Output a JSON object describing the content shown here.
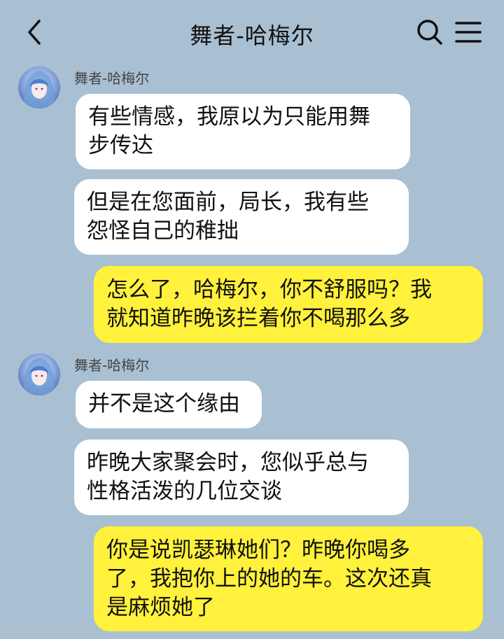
{
  "header": {
    "title": "舞者-哈梅尔",
    "back_icon": "chevron-left-icon",
    "search_icon": "search-icon",
    "menu_icon": "hamburger-menu-icon"
  },
  "colors": {
    "background": "#a9bfd2",
    "incoming_bubble": "#ffffff",
    "outgoing_bubble": "#fff13c"
  },
  "messages": [
    {
      "sender": "舞者-哈梅尔",
      "direction": "incoming",
      "bubbles": [
        "有些情感，我原以为只能用舞\n步传达",
        "但是在您面前，局长，我有些\n怨怪自己的稚拙"
      ]
    },
    {
      "direction": "outgoing",
      "bubbles": [
        "怎么了，哈梅尔，你不舒服吗？我\n就知道昨晚该拦着你不喝那么多"
      ]
    },
    {
      "sender": "舞者-哈梅尔",
      "direction": "incoming",
      "bubbles": [
        "并不是这个缘由",
        "昨晚大家聚会时，您似乎总与\n性格活泼的几位交谈"
      ]
    },
    {
      "direction": "outgoing",
      "bubbles": [
        "你是说凯瑟琳她们？昨晚你喝多\n了，我抱你上的她的车。这次还真\n是麻烦她了"
      ]
    }
  ]
}
